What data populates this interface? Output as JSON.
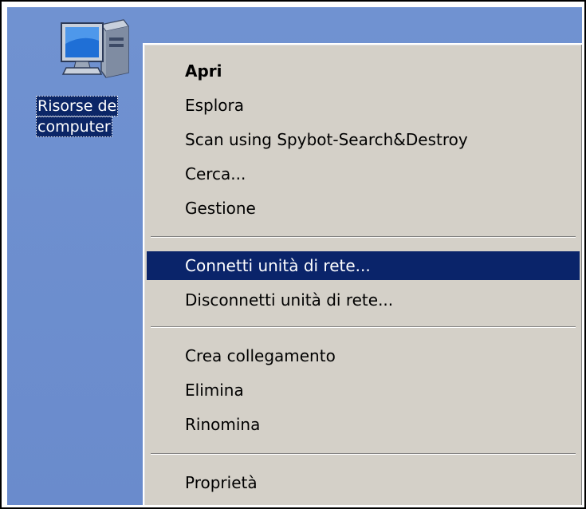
{
  "desktop": {
    "icon": {
      "name": "computer-icon",
      "label_line1": "Risorse de",
      "label_line2": "computer"
    }
  },
  "context_menu": {
    "items": [
      {
        "label": "Apri",
        "bold": true
      },
      {
        "label": "Esplora"
      },
      {
        "label": "Scan using Spybot-Search&Destroy"
      },
      {
        "label": "Cerca..."
      },
      {
        "label": "Gestione"
      },
      {
        "label": "Connetti unità di rete...",
        "selected": true
      },
      {
        "label": "Disconnetti unità di rete..."
      },
      {
        "label": "Crea collegamento"
      },
      {
        "label": "Elimina"
      },
      {
        "label": "Rinomina"
      },
      {
        "label": "Proprietà"
      }
    ]
  },
  "colors": {
    "desktop_bg": "#6d8ecf",
    "menu_bg": "#d4d0c8",
    "selection_bg": "#0a246a",
    "selection_text": "#ffffff"
  }
}
